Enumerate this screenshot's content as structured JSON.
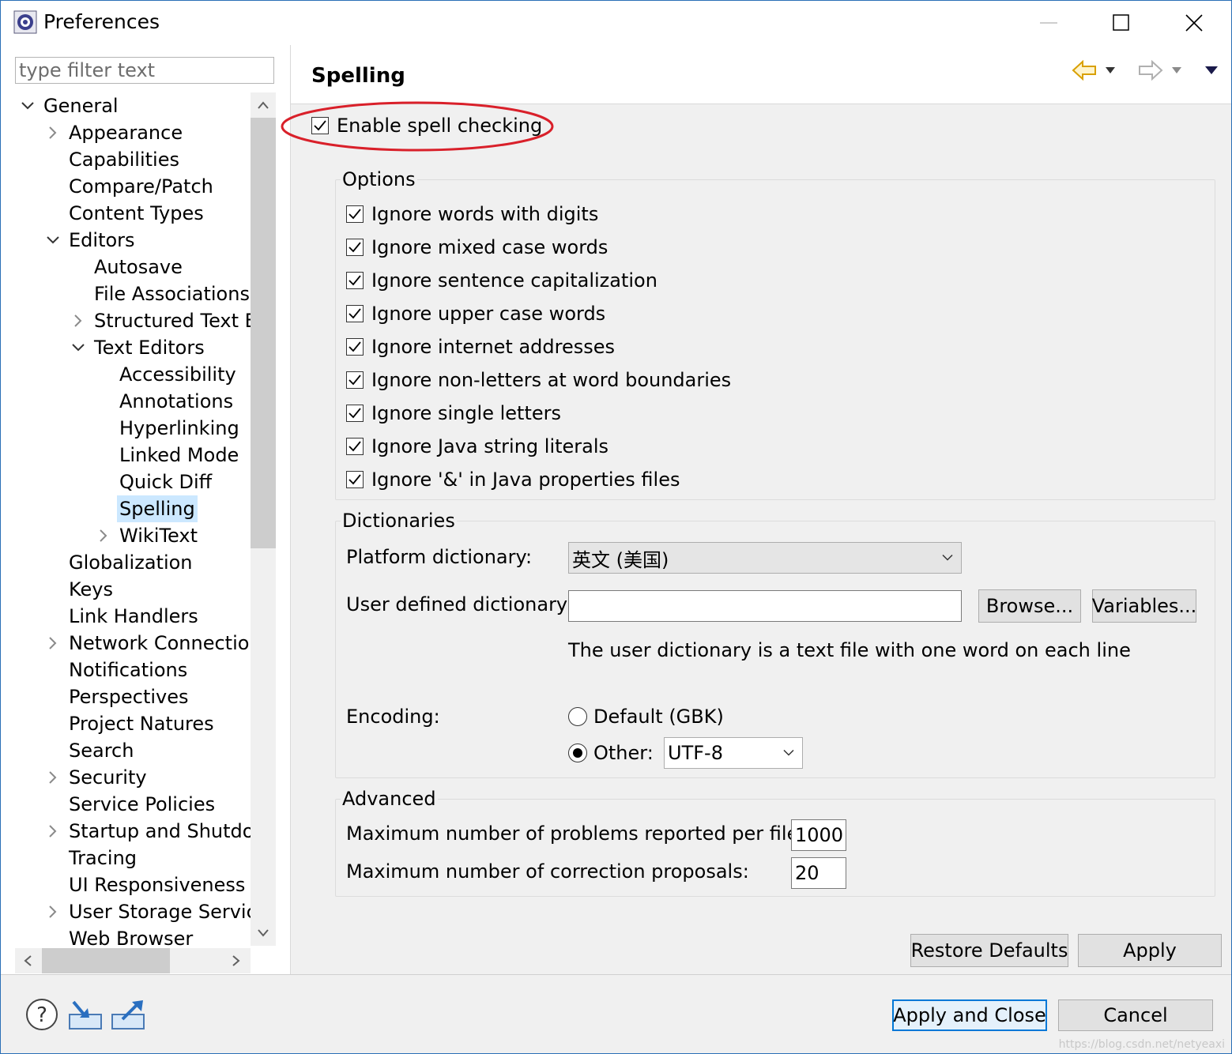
{
  "window": {
    "title": "Preferences"
  },
  "filter": {
    "placeholder": "type filter text",
    "value": ""
  },
  "tree": {
    "items": [
      {
        "label": "General",
        "level": 0,
        "twisty": "expanded"
      },
      {
        "label": "Appearance",
        "level": 1,
        "twisty": "collapsed"
      },
      {
        "label": "Capabilities",
        "level": 1,
        "twisty": ""
      },
      {
        "label": "Compare/Patch",
        "level": 1,
        "twisty": ""
      },
      {
        "label": "Content Types",
        "level": 1,
        "twisty": ""
      },
      {
        "label": "Editors",
        "level": 1,
        "twisty": "expanded"
      },
      {
        "label": "Autosave",
        "level": 2,
        "twisty": ""
      },
      {
        "label": "File Associations",
        "level": 2,
        "twisty": ""
      },
      {
        "label": "Structured Text E",
        "level": 2,
        "twisty": "collapsed"
      },
      {
        "label": "Text Editors",
        "level": 2,
        "twisty": "expanded"
      },
      {
        "label": "Accessibility",
        "level": 3,
        "twisty": ""
      },
      {
        "label": "Annotations",
        "level": 3,
        "twisty": ""
      },
      {
        "label": "Hyperlinking",
        "level": 3,
        "twisty": ""
      },
      {
        "label": "Linked Mode",
        "level": 3,
        "twisty": ""
      },
      {
        "label": "Quick Diff",
        "level": 3,
        "twisty": ""
      },
      {
        "label": "Spelling",
        "level": 3,
        "twisty": "",
        "selected": true
      },
      {
        "label": "WikiText",
        "level": 3,
        "twisty": "collapsed"
      },
      {
        "label": "Globalization",
        "level": 1,
        "twisty": ""
      },
      {
        "label": "Keys",
        "level": 1,
        "twisty": ""
      },
      {
        "label": "Link Handlers",
        "level": 1,
        "twisty": ""
      },
      {
        "label": "Network Connectior",
        "level": 1,
        "twisty": "collapsed"
      },
      {
        "label": "Notifications",
        "level": 1,
        "twisty": ""
      },
      {
        "label": "Perspectives",
        "level": 1,
        "twisty": ""
      },
      {
        "label": "Project Natures",
        "level": 1,
        "twisty": ""
      },
      {
        "label": "Search",
        "level": 1,
        "twisty": ""
      },
      {
        "label": "Security",
        "level": 1,
        "twisty": "collapsed"
      },
      {
        "label": "Service Policies",
        "level": 1,
        "twisty": ""
      },
      {
        "label": "Startup and Shutdov",
        "level": 1,
        "twisty": "collapsed"
      },
      {
        "label": "Tracing",
        "level": 1,
        "twisty": ""
      },
      {
        "label": "UI Responsiveness M",
        "level": 1,
        "twisty": ""
      },
      {
        "label": "User Storage Service",
        "level": 1,
        "twisty": "collapsed"
      },
      {
        "label": "Web Browser",
        "level": 1,
        "twisty": ""
      }
    ]
  },
  "page": {
    "title": "Spelling",
    "enable_label": "Enable spell checking",
    "enable_checked": true,
    "highlight_color": "#d9202a"
  },
  "options": {
    "title": "Options",
    "items": [
      {
        "label": "Ignore words with digits",
        "checked": true
      },
      {
        "label": "Ignore mixed case words",
        "checked": true
      },
      {
        "label": "Ignore sentence capitalization",
        "checked": true
      },
      {
        "label": "Ignore upper case words",
        "checked": true
      },
      {
        "label": "Ignore internet addresses",
        "checked": true
      },
      {
        "label": "Ignore non-letters at word boundaries",
        "checked": true
      },
      {
        "label": "Ignore single letters",
        "checked": true
      },
      {
        "label": "Ignore Java string literals",
        "checked": true
      },
      {
        "label": "Ignore '&' in Java properties files",
        "checked": true
      }
    ]
  },
  "dictionaries": {
    "title": "Dictionaries",
    "platform_label": "Platform dictionary:",
    "platform_value": "英文 (美国)",
    "user_label": "User defined dictionary:",
    "user_value": "",
    "browse_label": "Browse...",
    "variables_label": "Variables...",
    "hint": "The user dictionary is a text file with one word on each line",
    "encoding_label": "Encoding:",
    "default_encoding_label": "Default (GBK)",
    "other_label": "Other:",
    "other_value": "UTF-8",
    "selected_encoding": "other"
  },
  "advanced": {
    "title": "Advanced",
    "max_problems_label": "Maximum number of problems reported per file:",
    "max_problems_value": "1000",
    "max_proposals_label": "Maximum number of correction proposals:",
    "max_proposals_value": "20"
  },
  "buttons": {
    "restore_defaults": "Restore Defaults",
    "apply": "Apply",
    "apply_and_close": "Apply and Close",
    "cancel": "Cancel"
  },
  "icons": {
    "app": "eclipse-icon",
    "help": "help-icon",
    "import": "import-icon",
    "export": "export-icon",
    "back": "back-arrow-icon",
    "forward": "forward-arrow-icon",
    "menu": "view-menu-icon"
  },
  "watermark": "https://blog.csdn.net/netyeaxi"
}
